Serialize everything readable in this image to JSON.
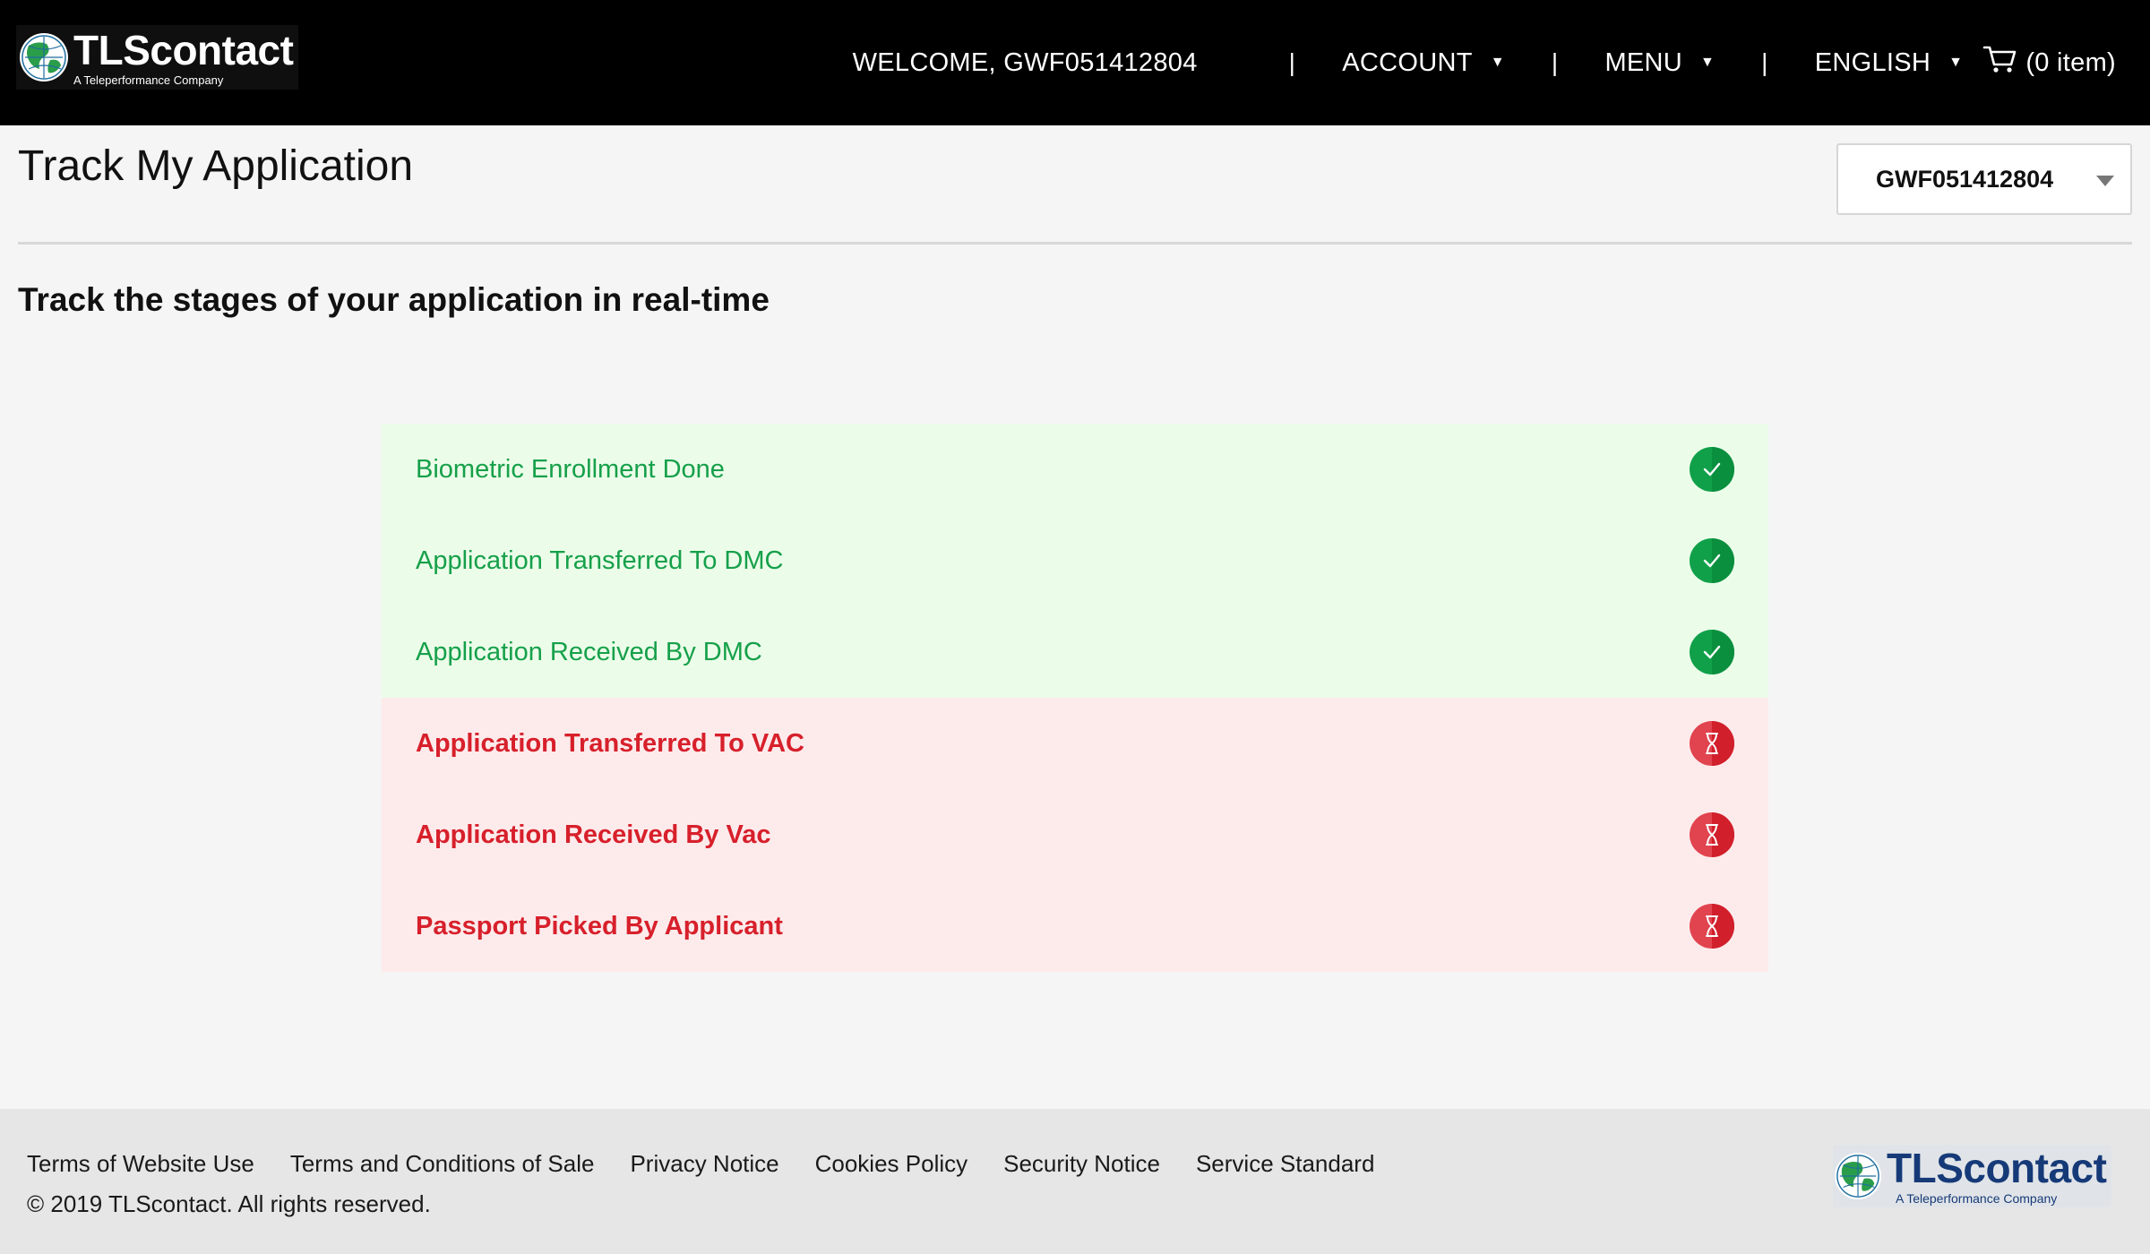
{
  "brand": {
    "name": "TLScontact",
    "tagline": "A Teleperformance Company"
  },
  "nav": {
    "welcome": "WELCOME, GWF051412804",
    "separator": "|",
    "account": "ACCOUNT",
    "menu": "MENU",
    "language": "ENGLISH",
    "cart": "(0 item)"
  },
  "page": {
    "title": "Track My Application",
    "application_select": "GWF051412804",
    "subtitle": "Track the stages of your application in real-time"
  },
  "stages": [
    {
      "label": "Biometric Enrollment Done",
      "status": "done",
      "icon": "check-icon"
    },
    {
      "label": "Application Transferred To DMC",
      "status": "done",
      "icon": "check-icon"
    },
    {
      "label": "Application Received By DMC",
      "status": "done",
      "icon": "check-icon"
    },
    {
      "label": "Application Transferred To VAC",
      "status": "pending",
      "icon": "hourglass-icon"
    },
    {
      "label": "Application Received By Vac",
      "status": "pending",
      "icon": "hourglass-icon"
    },
    {
      "label": "Passport Picked By Applicant",
      "status": "pending",
      "icon": "hourglass-icon"
    }
  ],
  "colors": {
    "done_text": "#16a04a",
    "done_bg": "#ebfde9",
    "pending_text": "#d7202b",
    "pending_bg": "#fdebec",
    "header_bg": "#000000",
    "footer_brand": "#163a78"
  },
  "footer": {
    "links": [
      "Terms of Website Use",
      "Terms and Conditions of Sale",
      "Privacy Notice",
      "Cookies Policy",
      "Security Notice",
      "Service Standard"
    ],
    "copyright": "© 2019 TLScontact. All rights reserved."
  }
}
